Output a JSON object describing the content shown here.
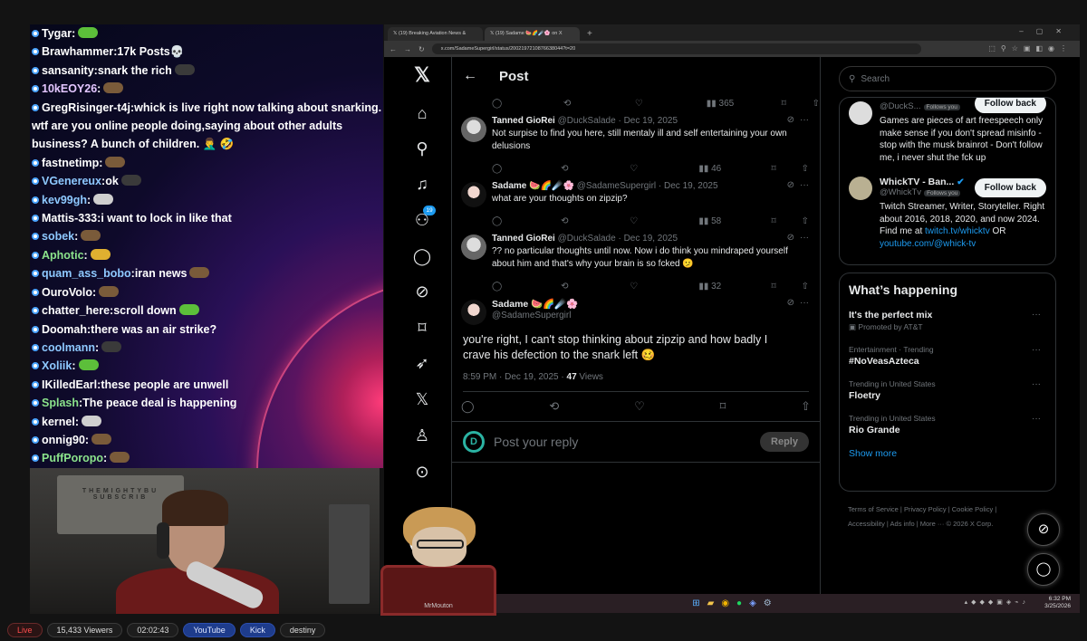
{
  "chat": {
    "lines": [
      {
        "user": "Tygar",
        "color": "#ffffff",
        "msg": "",
        "emote": "g"
      },
      {
        "user": "Brawhammer",
        "color": "#ffffff",
        "msg": "17k Posts💀",
        "emote": ""
      },
      {
        "user": "sansanity",
        "color": "#ffffff",
        "msg": "snark the rich",
        "emote": "d"
      },
      {
        "user": "10kEOY26",
        "color": "#e3c6ff",
        "msg": "",
        "emote": "b"
      },
      {
        "user": "GregRisinger-t4j",
        "color": "#ffffff",
        "msg": "whick is live right now talking about snarking. wtf are you online people doing,saying about other adults business? A bunch of children. 🤦‍♂️ 🤣",
        "emote": ""
      },
      {
        "user": "fastnetimp",
        "color": "#ffffff",
        "msg": "",
        "emote": "b"
      },
      {
        "user": "VGenereux",
        "color": "#8ec9ff",
        "msg": "ok",
        "emote": "d"
      },
      {
        "user": "kev99gh",
        "color": "#8ec9ff",
        "msg": "",
        "emote": "w"
      },
      {
        "user": "Mattis-333",
        "color": "#ffffff",
        "msg": "i want to lock in like that",
        "emote": ""
      },
      {
        "user": "sobek",
        "color": "#8ec9ff",
        "msg": "",
        "emote": "b"
      },
      {
        "user": "Aphotic",
        "color": "#8be38b",
        "msg": "",
        "emote": "y"
      },
      {
        "user": "quam_ass_bobo",
        "color": "#8ec9ff",
        "msg": "iran news",
        "emote": "b"
      },
      {
        "user": "OuroVolo",
        "color": "#ffffff",
        "msg": "",
        "emote": "b"
      },
      {
        "user": "chatter_here",
        "color": "#ffffff",
        "msg": "scroll down",
        "emote": "g"
      },
      {
        "user": "Doomah",
        "color": "#ffffff",
        "msg": "there was an air strike?",
        "emote": ""
      },
      {
        "user": "coolmann",
        "color": "#8ec9ff",
        "msg": "",
        "emote": "d"
      },
      {
        "user": "Xoliik",
        "color": "#8ec9ff",
        "msg": "",
        "emote": "g"
      },
      {
        "user": "IKilledEarl",
        "color": "#ffffff",
        "msg": "these people are unwell",
        "emote": ""
      },
      {
        "user": "Splash",
        "color": "#8be38b",
        "msg": "The peace deal is happening",
        "emote": ""
      },
      {
        "user": "kernel",
        "color": "#ffffff",
        "msg": "",
        "emote": "w"
      },
      {
        "user": "onnig90",
        "color": "#ffffff",
        "msg": "",
        "emote": "b"
      },
      {
        "user": "PuffPoropo",
        "color": "#8be38b",
        "msg": "",
        "emote": "b"
      }
    ]
  },
  "webcam": {
    "wall_text": "THEMIGHTYBU SUBSCRIB"
  },
  "status": {
    "live": "Live",
    "viewers": "15,433 Viewers",
    "uptime": "02:02:43",
    "youtube": "YouTube",
    "kick": "Kick",
    "channel": "destiny"
  },
  "browser": {
    "tab1": "(19) Breaking Aviation News &",
    "tab2": "(19) Sadame 🍉🌈☄️🌸 on X",
    "url": "x.com/SadameSupergirl/status/2002197210876638044?t=20"
  },
  "x": {
    "header_title": "Post",
    "notif_count": "19",
    "top_stats": {
      "views": "365"
    },
    "replies": [
      {
        "name": "Tanned GioRei",
        "handle": "@DuckSalade · Dec 19, 2025",
        "body": "Not surpise to find you here, still mentaly ill and self entertaining your own delusions",
        "views": "46",
        "avatar": "g"
      },
      {
        "name": "Sadame 🍉🌈☄️🌸",
        "handle": "@SadameSupergirl · Dec 19, 2025",
        "body": "what are your thoughts on zipzip?",
        "views": "58",
        "avatar": "s"
      },
      {
        "name": "Tanned GioRei",
        "handle": "@DuckSalade · Dec 19, 2025",
        "body": "?? no particular thoughts until now. Now i do think you mindraped yourself about him and that's why your brain is so fcked 🫤",
        "views": "32",
        "avatar": "g"
      }
    ],
    "main_post": {
      "name": "Sadame 🍉🌈☄️🌸",
      "handle": "@SadameSupergirl",
      "text": "you're right, I can't stop thinking about zipzip and how badly I crave his defection to the snark left 🥴",
      "time": "8:59 PM · Dec 19, 2025 · ",
      "views": "47",
      "views_label": " Views"
    },
    "reply_placeholder": "Post your reply",
    "reply_button": "Reply",
    "search_placeholder": "Search",
    "who_to_follow": [
      {
        "name": "",
        "handle": "@DuckS...",
        "follows_you": "Follows you",
        "bio": "Games are pieces of art freespeech only make sense if you don't spread misinfo - stop with the musk brainrot - Don't follow me, i never shut the fck up",
        "button": "Follow back"
      },
      {
        "name": "WhickTV - Ban...",
        "handle": "@WhickTv",
        "follows_you": "Follows you",
        "bio": "Twitch Streamer, Writer, Storyteller. Right about 2016, 2018, 2020, and now 2024. Find me at ",
        "link1": "twitch.tv/whicktv",
        "mid": " OR ",
        "link2": "youtube.com/@whick-tv",
        "button": "Follow back"
      }
    ],
    "happening": {
      "title": "What’s happening",
      "trends": [
        {
          "category": "",
          "title": "It's the perfect mix",
          "promoted": "Promoted by AT&T"
        },
        {
          "category": "Entertainment · Trending",
          "title": "#NoVeasAzteca",
          "promoted": ""
        },
        {
          "category": "Trending in United States",
          "title": "Floetry",
          "promoted": ""
        },
        {
          "category": "Trending in United States",
          "title": "Rio Grande",
          "promoted": ""
        }
      ],
      "show_more": "Show more"
    },
    "footer": {
      "line1": "Terms of Service  |  Privacy Policy  |  Cookie Policy  |",
      "line2": "Accessibility  |  Ads info  |  More ···  © 2026 X Corp."
    }
  },
  "taskbar": {
    "time": "6:32 PM",
    "date": "3/25/2026"
  },
  "mascot": {
    "label": "MrMouton"
  }
}
